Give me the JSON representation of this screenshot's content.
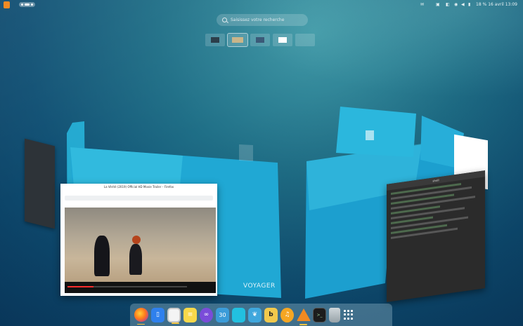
{
  "search": {
    "placeholder": "Saisissez votre recherche"
  },
  "topbar": {
    "date_time": "16 avril  13:09",
    "battery": "18 %"
  },
  "video_window": {
    "title": "La Vérité (2019) Official HD Movie Trailer – Firefox",
    "progress": 0.22
  },
  "terminal": {
    "title": "shell"
  },
  "wallpaper": {
    "brand": "VOYAGER"
  },
  "workspaces": [
    "ws1",
    "ws2",
    "ws3",
    "ws4",
    "ws5"
  ],
  "dock": {
    "apps": [
      "firefox-icon",
      "phone-icon",
      "notes-icon",
      "sticky-notes-icon",
      "privacy-mask-icon",
      "calendar-icon",
      "cyan-app-icon",
      "python-icon",
      "bi-app-icon",
      "headphones-icon",
      "vlc-icon",
      "terminal-icon",
      "trash-icon",
      "app-grid-icon"
    ],
    "calendar_day": "30"
  },
  "colors": {
    "accent": "#1fa8d4",
    "brand_orange": "#f08a24"
  }
}
